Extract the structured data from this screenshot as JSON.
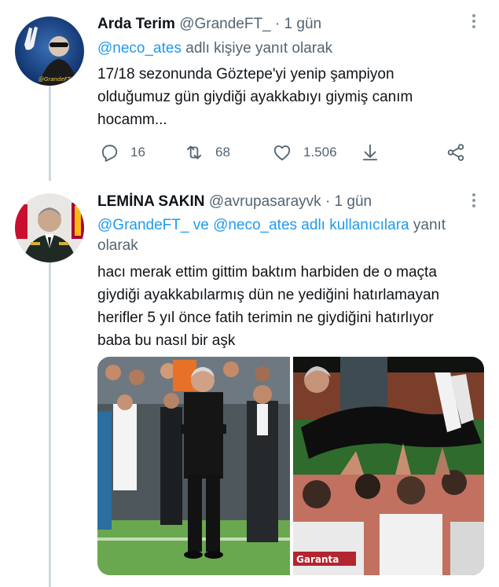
{
  "tweets": [
    {
      "name": "Arda Terim",
      "handle": "@GrandeFT_",
      "separator": "·",
      "time": "1 gün",
      "reply_mentions": [
        "@neco_ates"
      ],
      "reply_suffix": "adlı kişiye yanıt olarak",
      "text_lines": [
        "17/18 sezonunda Göztepe'yi yenip şampiyon",
        "olduğumuz gün giydiği ayakkabıyı giymiş canım",
        "hocamm..."
      ],
      "actions": {
        "reply": "16",
        "retweet": "68",
        "like": "1.506"
      }
    },
    {
      "name": "LEMİNA SAKIN",
      "handle": "@avrupasarayvk",
      "separator": "·",
      "time": "1 gün",
      "reply_line1": "@GrandeFT_ ve @neco_ates adlı kullanıcılara",
      "reply_line1_suffix": "yanıt",
      "reply_line2": "olarak",
      "text_lines": [
        "hacı merak ettim gittim baktım harbiden de o maçta",
        "giydiği ayakkabılarmış dün ne yediğini hatırlamayan",
        "herifler 5 yıl önce fatih terimin ne giydiğini hatırlıyor",
        "baba bu nasıl bir aşk"
      ],
      "photo_text": "Garanta"
    }
  ],
  "colors": {
    "link": "#1d9bf0",
    "muted": "#536471",
    "text": "#0f1419",
    "thread_line": "#cfd9de"
  },
  "icons": {
    "reply": "reply-icon",
    "retweet": "retweet-icon",
    "like": "heart-icon",
    "download": "download-icon",
    "share": "share-icon",
    "more": "more-dots-icon"
  }
}
